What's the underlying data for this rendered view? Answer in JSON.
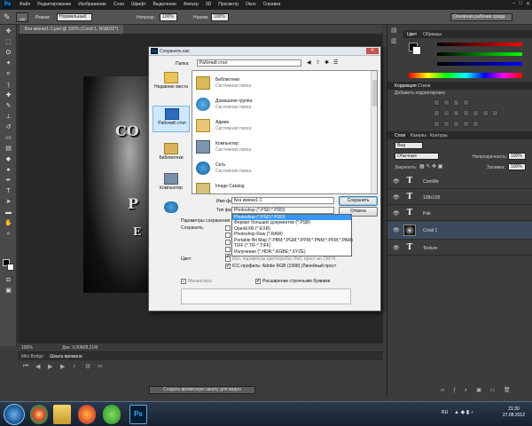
{
  "app": {
    "logo": "Ps"
  },
  "menubar": {
    "items": [
      "Файл",
      "Редактирование",
      "Изображение",
      "Слои",
      "Шрифт",
      "Выделение",
      "Фильтр",
      "3D",
      "Просмотр",
      "Окно",
      "Справка"
    ]
  },
  "options": {
    "mode_label": "Режим:",
    "mode_value": "Нормальный",
    "opacity_label": "Непрозр.:",
    "opacity_value": "100%",
    "flow_label": "Нажим:",
    "flow_value": "100%",
    "workspace": "Основная рабочая среда",
    "size_value": "180"
  },
  "document_tab": {
    "title": "Без имени1-1.psd @ 100% (Слой 1, RGB/32*)"
  },
  "canvas": {
    "text1": "CO",
    "text2": "P",
    "text3": "E"
  },
  "status": {
    "zoom": "100%",
    "doc": "Док: 3,00M/8,21M"
  },
  "bottom_panel": {
    "tab1": "Mini Bridge",
    "tab2": "Шкала времени",
    "timeline_button": "Создать временную шкалу для видео"
  },
  "right": {
    "color_tabs": [
      "Цвет",
      "Образцы"
    ],
    "correction_tabs": [
      "Коррекция",
      "Стили"
    ],
    "correction_title": "Добавить корректировку",
    "layers_tabs": [
      "Слои",
      "Каналы",
      "Контуры"
    ],
    "filter_label": "Вид",
    "blend_mode": "Обычные",
    "opacity_label": "Непрозрачность:",
    "opacity_value": "100%",
    "lock_label": "Закрепить:",
    "fill_label": "Заливка:",
    "fill_value": "100%",
    "layers": [
      {
        "name": "ComWe",
        "type": "text"
      },
      {
        "name": "128x128",
        "type": "text"
      },
      {
        "name": "Pak",
        "type": "text"
      },
      {
        "name": "Слой 1",
        "type": "image"
      },
      {
        "name": "Texture",
        "type": "text"
      }
    ]
  },
  "dialog": {
    "title": "Сохранить как",
    "folder_label": "Папка:",
    "folder_value": "Рабочий стол",
    "places": [
      "Недавние места",
      "Рабочий стол",
      "Библиотеки",
      "Компьютер"
    ],
    "files": [
      {
        "name": "Библиотеки",
        "sub": "Системная папка"
      },
      {
        "name": "Домашняя группа",
        "sub": "Системная папка"
      },
      {
        "name": "Админ",
        "sub": "Системная папка"
      },
      {
        "name": "Компьютер",
        "sub": "Системная папка"
      },
      {
        "name": "Сеть",
        "sub": "Системная папка"
      },
      {
        "name": "Image Catalog",
        "sub": ""
      }
    ],
    "filename_label": "Имя файла:",
    "filename_value": "Без имени1-1",
    "filetype_label": "Тип файлов:",
    "filetype_value": "Photoshop (*.PSD;*.PDD)",
    "save_button": "Сохранить",
    "cancel_button": "Отмена",
    "params_label": "Параметры сохранения",
    "save_label": "Сохранить:",
    "color_label": "Цвет:",
    "proof_label": "Исп. параметры цветопробы: Раб. прост-во CMYK",
    "icc_label": "ICC-профиль: Adobe RGB (1998) (Линейный прост",
    "thumb_label": "Миниатюра",
    "ext_label": "Расширение строчными буквами",
    "dropdown": [
      "Photoshop (*.PSD;*.PDD)",
      "Формат больших документов (*.PSB)",
      "OpenEXR (*.EXR)",
      "Photoshop Raw (*.RAW)",
      "Portable Bit Map (*.PBM;*.PGM;*.PPM;*.PNM;*.PFM;*.PAM)",
      "TIFF (*.TIF;*.TIFF)",
      "Излучение (*.HDR;*.RGBE;*.XYZE)"
    ]
  },
  "taskbar": {
    "lang": "RU",
    "time": "21:30",
    "date": "27.08.2012"
  }
}
